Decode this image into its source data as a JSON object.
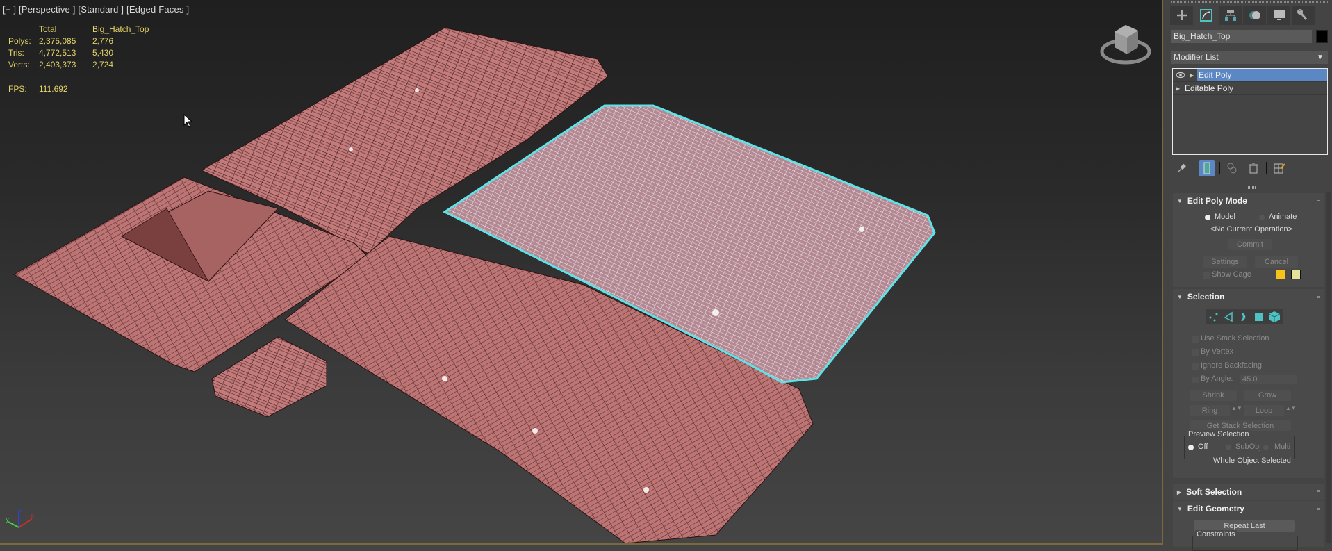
{
  "viewport": {
    "label": "[+ ] [Perspective ] [Standard ] [Edged Faces ]",
    "stats": {
      "headers": [
        "",
        "Total",
        "Big_Hatch_Top"
      ],
      "rows": [
        {
          "label": "Polys:",
          "total": "2,375,085",
          "selected": "2,776"
        },
        {
          "label": "Tris:",
          "total": "4,772,513",
          "selected": "5,430"
        },
        {
          "label": "Verts:",
          "total": "2,403,373",
          "selected": "2,724"
        }
      ],
      "fps_label": "FPS:",
      "fps_value": "111.692"
    },
    "axis_labels": {
      "x": "x",
      "y": "y",
      "z": "z"
    },
    "colors": {
      "mesh": "#c27a7a",
      "mesh_dark": "#8a4e4e",
      "selection_outline": "#5de3e8",
      "stats_text": "#e2d36a"
    }
  },
  "command_panel": {
    "tabs": [
      {
        "name": "create",
        "icon": "plus-icon"
      },
      {
        "name": "modify",
        "icon": "modify-icon",
        "active": true
      },
      {
        "name": "hierarchy",
        "icon": "hierarchy-icon"
      },
      {
        "name": "motion",
        "icon": "motion-icon"
      },
      {
        "name": "display",
        "icon": "display-icon"
      },
      {
        "name": "utilities",
        "icon": "wrench-icon"
      }
    ],
    "object_name": "Big_Hatch_Top",
    "object_color": "#000000",
    "modifier_list": "Modifier List",
    "stack": [
      {
        "label": "Edit Poly",
        "selected": true
      },
      {
        "label": "Editable Poly",
        "selected": false
      }
    ],
    "edit_poly_mode": {
      "title": "Edit Poly Mode",
      "model_label": "Model",
      "animate_label": "Animate",
      "mode": "Model",
      "operation": "<No Current Operation>",
      "commit": "Commit",
      "settings": "Settings",
      "cancel": "Cancel",
      "show_cage": "Show Cage",
      "cage_colors": [
        "#f5c31a",
        "#e2e29a"
      ]
    },
    "selection": {
      "title": "Selection",
      "use_stack_selection": "Use Stack Selection",
      "by_vertex": "By Vertex",
      "ignore_backfacing": "Ignore Backfacing",
      "by_angle": "By Angle:",
      "angle_value": "45.0",
      "shrink": "Shrink",
      "grow": "Grow",
      "ring": "Ring",
      "loop": "Loop",
      "get_stack_selection": "Get Stack Selection",
      "preview_selection": "Preview Selection",
      "preview_off": "Off",
      "preview_subobj": "SubObj",
      "preview_multi": "Multi",
      "preview_mode": "Off",
      "status": "Whole Object Selected"
    },
    "soft_selection": {
      "title": "Soft Selection"
    },
    "edit_geometry": {
      "title": "Edit Geometry",
      "repeat_last": "Repeat Last",
      "constraints": "Constraints"
    }
  }
}
